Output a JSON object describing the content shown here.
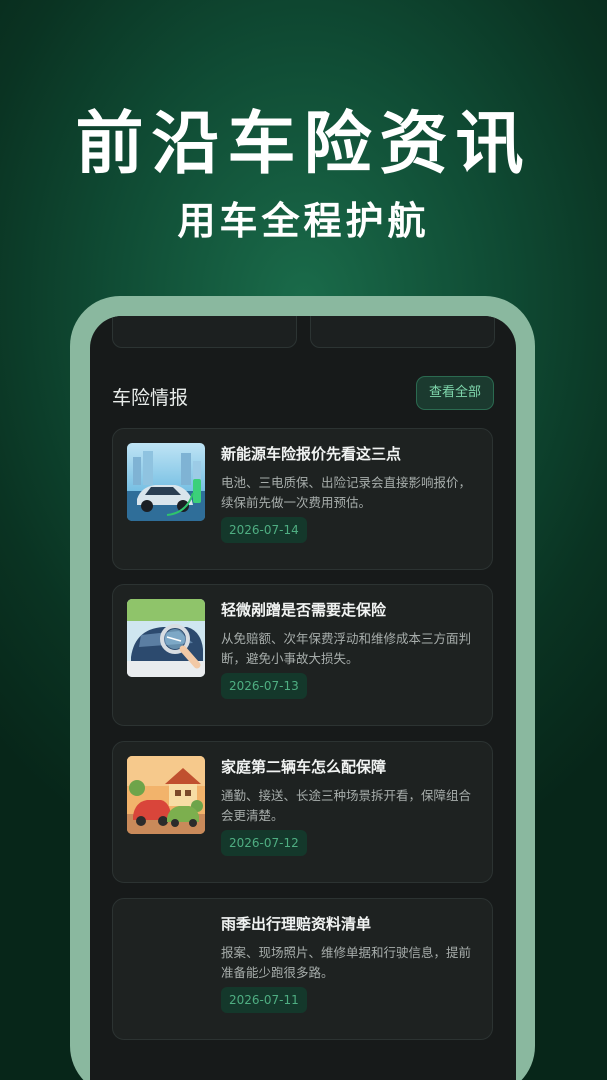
{
  "hero": {
    "title": "前沿车险资讯",
    "subtitle": "用车全程护航"
  },
  "section": {
    "title": "车险情报",
    "view_all_label": "查看全部"
  },
  "news": [
    {
      "title": "新能源车险报价先看这三点",
      "desc": "电池、三电质保、出险记录会直接影响报价，续保前先做一次费用预估。",
      "date": "2026-07-14",
      "thumb_icon": "ev-charging-car-image"
    },
    {
      "title": "轻微剐蹭是否需要走保险",
      "desc": "从免赔额、次年保费浮动和维修成本三方面判断，避免小事故大损失。",
      "date": "2026-07-13",
      "thumb_icon": "car-scratch-inspection-image"
    },
    {
      "title": "家庭第二辆车怎么配保障",
      "desc": "通勤、接送、长途三种场景拆开看，保障组合会更清楚。",
      "date": "2026-07-12",
      "thumb_icon": "family-cars-house-image"
    },
    {
      "title": "雨季出行理赔资料清单",
      "desc": "报案、现场照片、维修单据和行驶信息，提前准备能少跑很多路。",
      "date": "2026-07-11",
      "thumb_icon": ""
    }
  ],
  "colors": {
    "accent": "#4fae82",
    "frame": "#8ab89f",
    "background": "#0f4a33"
  }
}
